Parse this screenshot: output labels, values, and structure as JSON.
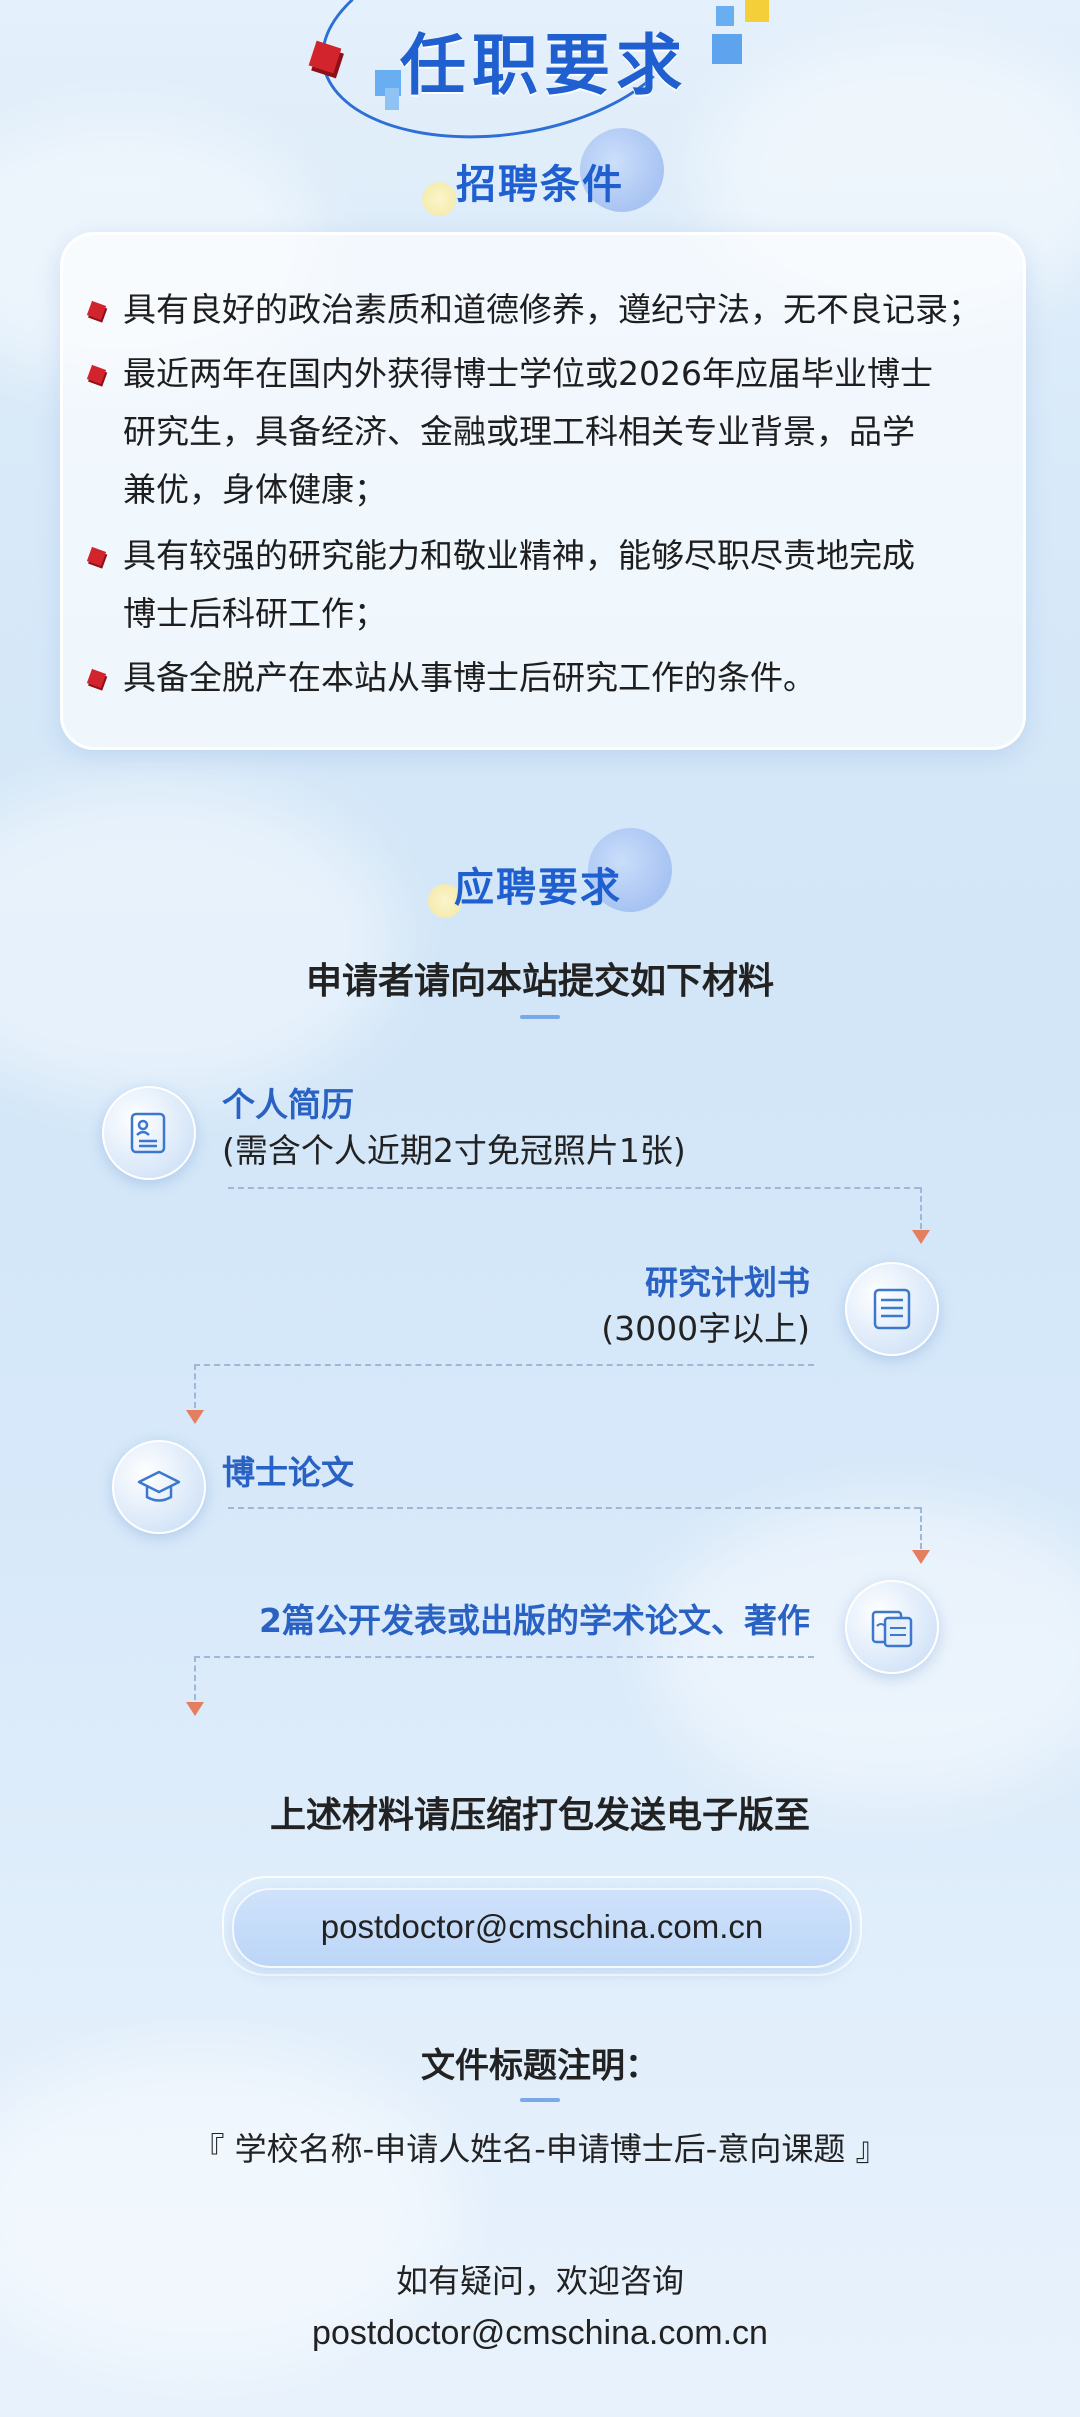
{
  "title": "任职要求",
  "conditions": {
    "heading": "招聘条件",
    "items": [
      "具有良好的政治素质和道德修养，遵纪守法，无不良记录；",
      "最近两年在国内外获得博士学位或2026年应届毕业博士",
      "研究生，具备经济、金融或理工科相关专业背景，品学",
      "兼优，身体健康；",
      "具有较强的研究能力和敬业精神，能够尽职尽责地完成",
      "博士后科研工作；",
      "具备全脱产在本站从事博士后研究工作的条件。"
    ]
  },
  "application": {
    "heading": "应聘要求",
    "intro": "申请者请向本站提交如下材料",
    "steps": [
      {
        "title": "个人简历",
        "sub": "(需含个人近期2寸免冠照片1张)",
        "icon": "resume-icon"
      },
      {
        "title": "研究计划书",
        "sub": "(3000字以上)",
        "icon": "document-icon"
      },
      {
        "title": "博士论文",
        "sub": "",
        "icon": "graduation-cap-icon"
      },
      {
        "title": "2篇公开发表或出版的学术论文、著作",
        "sub": "",
        "icon": "paper-icon"
      }
    ],
    "submit_text": "上述材料请压缩打包发送电子版至",
    "email": "postdoctor@cmschina.com.cn",
    "file_title_heading": "文件标题注明：",
    "file_title_format": "『 学校名称-申请人姓名-申请博士后-意向课题 』",
    "contact_text": "如有疑问，欢迎咨询",
    "contact_email": "postdoctor@cmschina.com.cn"
  },
  "colors": {
    "accent": "#1f5fcf",
    "bullet": "#d2242c",
    "arrow": "#e57d5f"
  }
}
